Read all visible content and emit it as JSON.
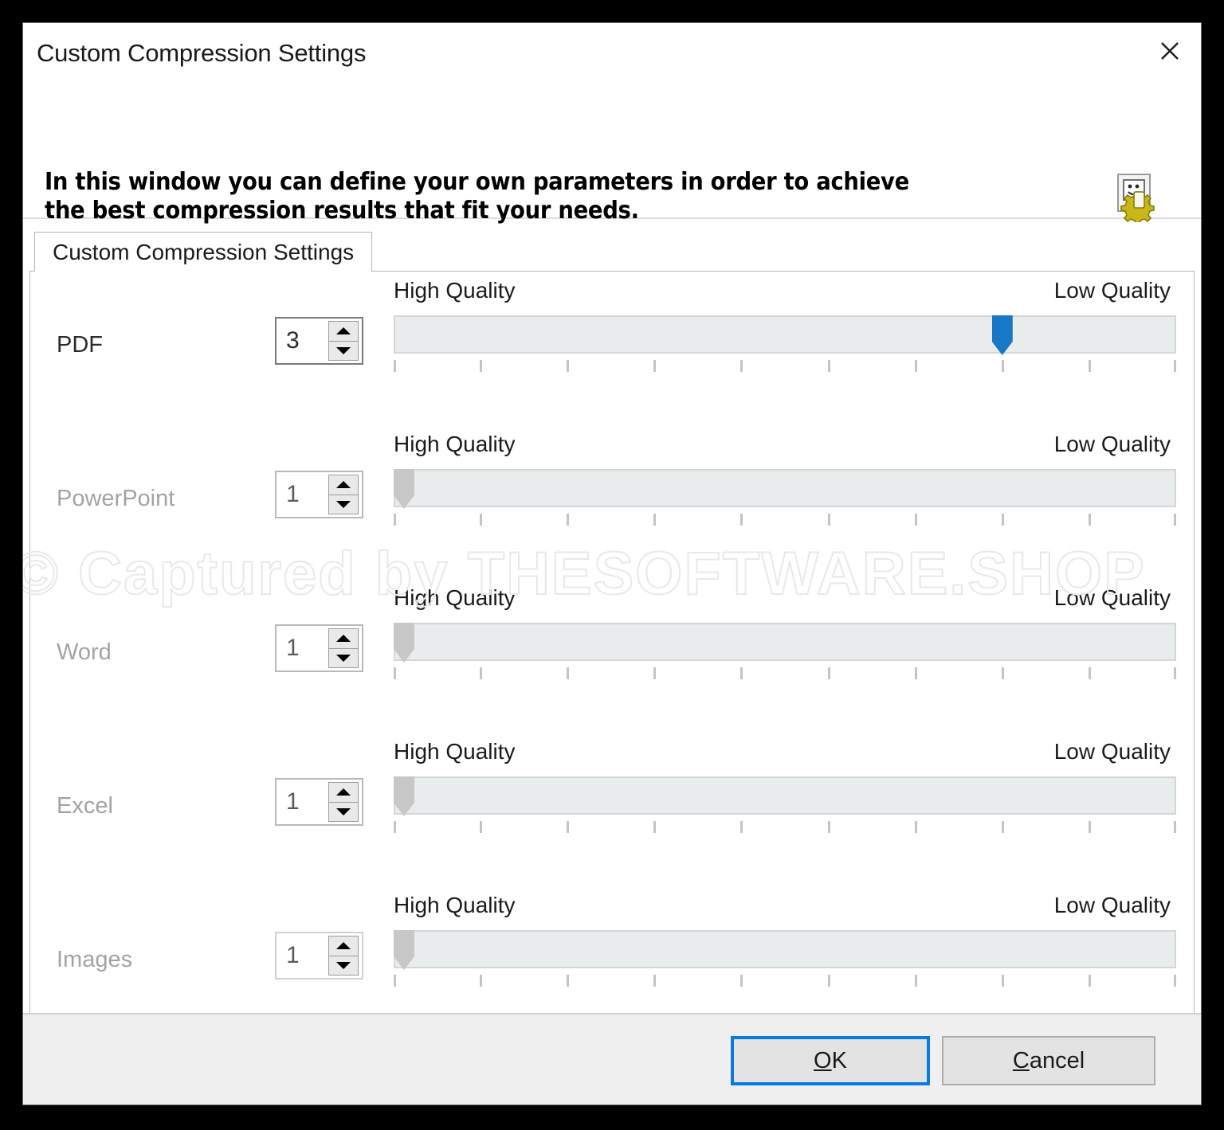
{
  "window": {
    "title": "Custom Compression Settings",
    "close_icon": "close-icon"
  },
  "header": {
    "text": "In this window you can define your own parameters in order to achieve the best compression results that fit your needs.",
    "icon": "document-gear-icon"
  },
  "tabs": [
    {
      "label": "Custom Compression Settings",
      "active": true
    }
  ],
  "quality": {
    "left_label": "High Quality",
    "right_label": "Low Quality",
    "tick_count": 10,
    "min": 1,
    "max": 10,
    "enabled_thumb_color": "#1878c8",
    "disabled_thumb_color": "#c7c7c7",
    "rail_color": "#e9ecec"
  },
  "rows": [
    {
      "label": "PDF",
      "value": "3",
      "slider_value": 8,
      "enabled": true,
      "high_quality": "High Quality",
      "low_quality": "Low Quality"
    },
    {
      "label": "PowerPoint",
      "value": "1",
      "slider_value": 1,
      "enabled": false,
      "high_quality": "High Quality",
      "low_quality": "Low Quality"
    },
    {
      "label": "Word",
      "value": "1",
      "slider_value": 1,
      "enabled": false,
      "high_quality": "High Quality",
      "low_quality": "Low Quality"
    },
    {
      "label": "Excel",
      "value": "1",
      "slider_value": 1,
      "enabled": false,
      "high_quality": "High Quality",
      "low_quality": "Low Quality"
    },
    {
      "label": "Images",
      "value": "1",
      "slider_value": 1,
      "enabled": false,
      "high_quality": "High Quality",
      "low_quality": "Low Quality"
    }
  ],
  "footer": {
    "ok_label": "OK",
    "ok_accel": "O",
    "ok_rest": "K",
    "cancel_label": "Cancel",
    "cancel_accel": "C",
    "cancel_rest": "ancel",
    "focus_color": "#0a7ae0"
  },
  "watermark": {
    "text": "© Captured by THESOFTWARE.SHOP"
  }
}
